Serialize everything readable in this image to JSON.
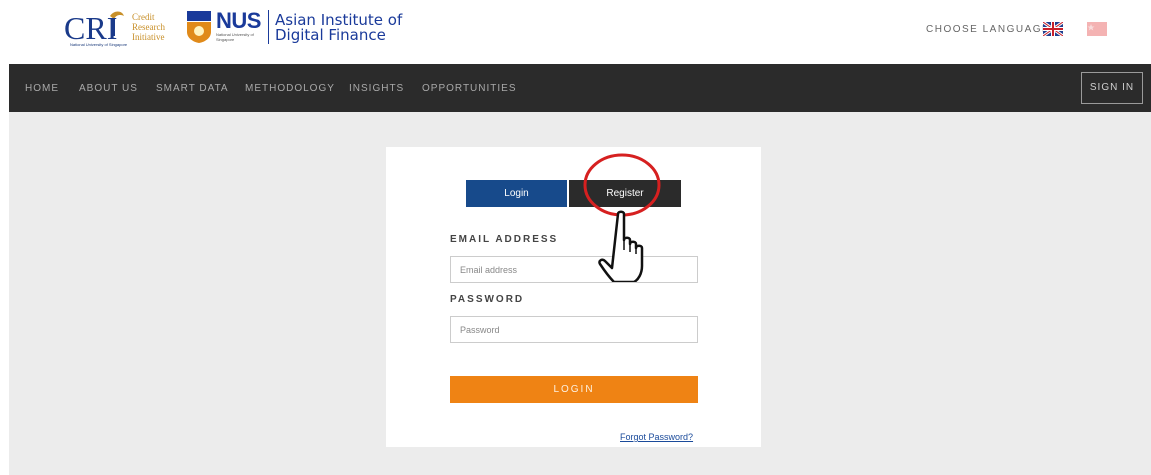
{
  "header": {
    "cri_lines": [
      "Credit",
      "Research",
      "Initiative"
    ],
    "cri_sub": "National University of Singapore",
    "nus_label": "NUS",
    "nus_sub": "National University of Singapore",
    "aidf_line1": "Asian Institute of",
    "aidf_line2": "Digital Finance",
    "language_label": "CHOOSE LANGUAGE"
  },
  "nav": {
    "items": [
      "HOME",
      "ABOUT US",
      "SMART DATA",
      "METHODOLOGY",
      "INSIGHTS",
      "OPPORTUNITIES"
    ],
    "sign_in": "SIGN IN"
  },
  "form": {
    "tab_login": "Login",
    "tab_register": "Register",
    "email_label": "EMAIL ADDRESS",
    "email_placeholder": "Email address",
    "email_value": "",
    "password_label": "PASSWORD",
    "password_placeholder": "Password",
    "password_value": "",
    "login_button": "LOGIN",
    "forgot_link": "Forgot Password?"
  },
  "colors": {
    "nav_bg": "#2b2b2b",
    "login_tab": "#174a8b",
    "login_button": "#ef8314",
    "annotation": "#d62020"
  }
}
